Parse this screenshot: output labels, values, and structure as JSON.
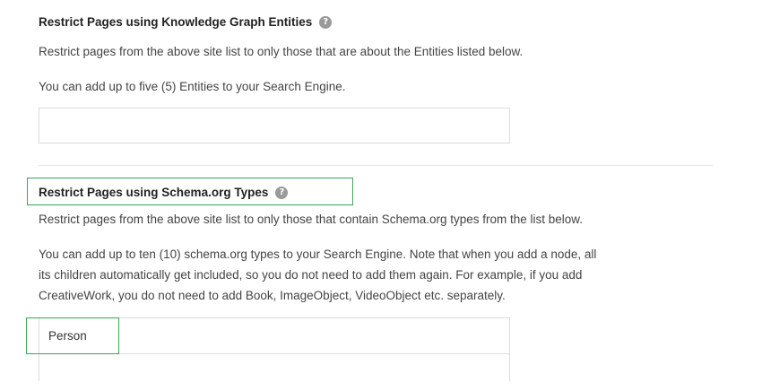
{
  "section1": {
    "title": "Restrict Pages using Knowledge Graph Entities",
    "description": "Restrict pages from the above site list to only those that are about the Entities listed below.",
    "limit_note": "You can add up to five (5) Entities to your Search Engine.",
    "input_value": ""
  },
  "section2": {
    "title": "Restrict Pages using Schema.org Types",
    "description": "Restrict pages from the above site list to only those that contain Schema.org types from the list below.",
    "note_line1": "You can add up to ten (10) schema.org types to your Search Engine. Note that when you add a node, all",
    "note_line2": "its children automatically get included, so you do not need to add them again. For example, if you add",
    "note_line3": "CreativeWork, you do not need to add Book, ImageObject, VideoObject etc. separately.",
    "selected_type": "Person"
  },
  "icons": {
    "help": "question-circle-icon"
  },
  "colors": {
    "highlight": "#3aa65a",
    "help_icon": "#9a9a9a"
  }
}
